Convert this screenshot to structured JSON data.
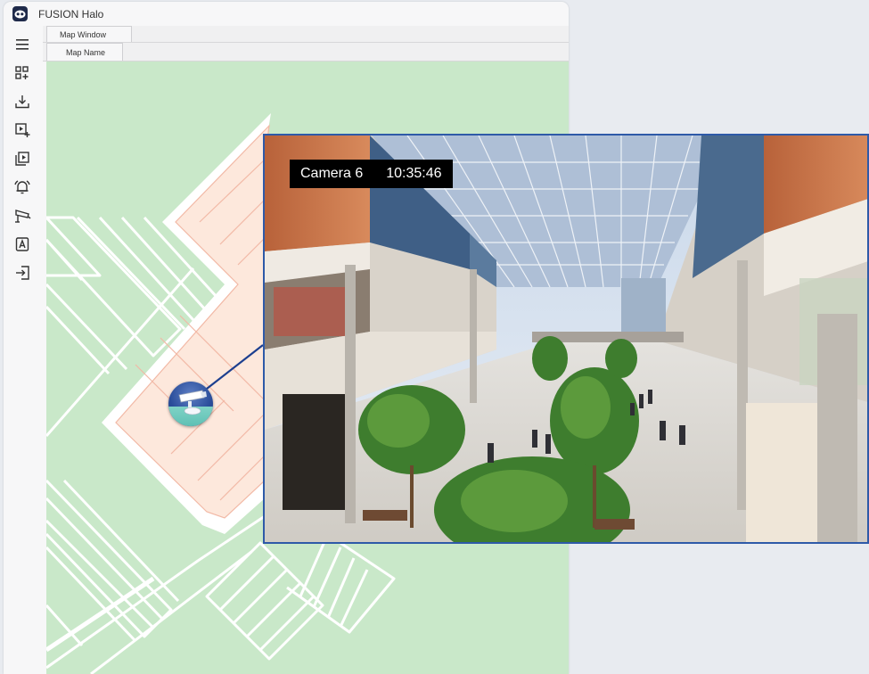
{
  "app": {
    "title": "FUSION Halo"
  },
  "sidebar": {
    "items": [
      {
        "icon": "menu-icon"
      },
      {
        "icon": "add-widget-icon"
      },
      {
        "icon": "download-icon"
      },
      {
        "icon": "add-video-icon"
      },
      {
        "icon": "playlist-icon"
      },
      {
        "icon": "alarm-bell-icon"
      },
      {
        "icon": "camera-icon"
      },
      {
        "icon": "text-frame-icon"
      },
      {
        "icon": "sign-in-icon"
      }
    ]
  },
  "tabs": {
    "window_tab": "Map Window",
    "map_tab": "Map Name"
  },
  "video": {
    "camera_name": "Camera 6",
    "timestamp": "10:35:46"
  },
  "colors": {
    "map_background": "#c9e8c9",
    "building_fill": "#fde8dc",
    "popup_border": "#2e5aa8"
  }
}
